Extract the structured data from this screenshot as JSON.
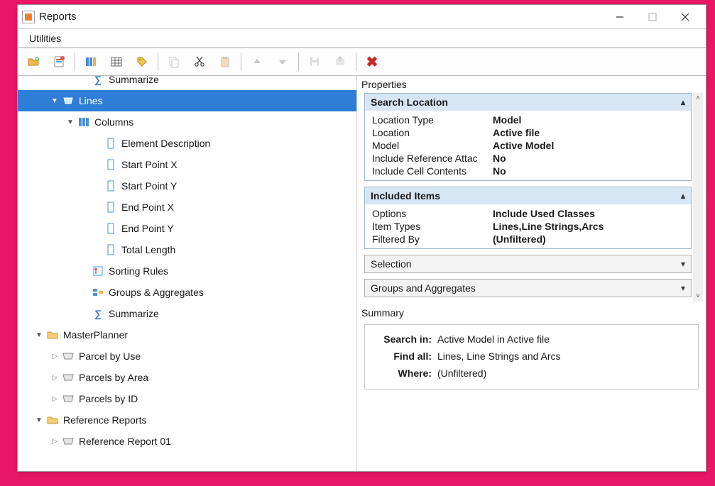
{
  "titlebar": {
    "title": "Reports"
  },
  "menubar": {
    "utilities": "Utilities"
  },
  "toolbar": {
    "new_folder_icon": "new-folder-icon",
    "new_report_icon": "new-report-icon",
    "columns_icon": "columns-icon",
    "table_icon": "table-icon",
    "tag_icon": "tag-icon",
    "copy_icon": "copy-icon",
    "cut_icon": "cut-icon",
    "paste_icon": "paste-icon",
    "move_up_icon": "move-up-icon",
    "move_down_icon": "move-down-icon",
    "save_icon": "save-icon",
    "export_icon": "export-icon",
    "close_icon": "close-icon"
  },
  "tree": {
    "summarize0": "Summarize",
    "lines": "Lines",
    "columns": "Columns",
    "col_elem_desc": "Element Description",
    "col_start_x": "Start Point X",
    "col_start_y": "Start Point Y",
    "col_end_x": "End Point X",
    "col_end_y": "End Point Y",
    "col_total_len": "Total Length",
    "sorting_rules": "Sorting Rules",
    "groups_aggr": "Groups & Aggregates",
    "summarize": "Summarize",
    "master_planner": "MasterPlanner",
    "parcel_by_use": "Parcel by Use",
    "parcels_by_area": "Parcels by Area",
    "parcels_by_id": "Parcels by ID",
    "reference_reports": "Reference Reports",
    "ref_report_01": "Reference Report 01"
  },
  "properties": {
    "title": "Properties",
    "search_location": {
      "title": "Search Location",
      "rows": {
        "location_type": {
          "name": "Location Type",
          "value": "Model"
        },
        "location": {
          "name": "Location",
          "value": "Active file"
        },
        "model": {
          "name": "Model",
          "value": "Active Model"
        },
        "include_ref": {
          "name": "Include Reference Attac",
          "value": "No"
        },
        "include_cell": {
          "name": "Include Cell Contents",
          "value": "No"
        }
      }
    },
    "included_items": {
      "title": "Included Items",
      "rows": {
        "options": {
          "name": "Options",
          "value": "Include Used Classes"
        },
        "item_types": {
          "name": "Item Types",
          "value": "Lines,Line Strings,Arcs"
        },
        "filtered_by": {
          "name": "Filtered By",
          "value": "(Unfiltered)"
        }
      }
    },
    "selection": {
      "title": "Selection"
    },
    "groups_aggr": {
      "title": "Groups and Aggregates"
    }
  },
  "summary": {
    "title": "Summary",
    "rows": {
      "search_in": {
        "name": "Search in:",
        "value": "Active Model  in Active file"
      },
      "find_all": {
        "name": "Find all:",
        "value": "Lines, Line Strings and Arcs"
      },
      "where": {
        "name": "Where:",
        "value": "(Unfiltered)"
      }
    }
  }
}
